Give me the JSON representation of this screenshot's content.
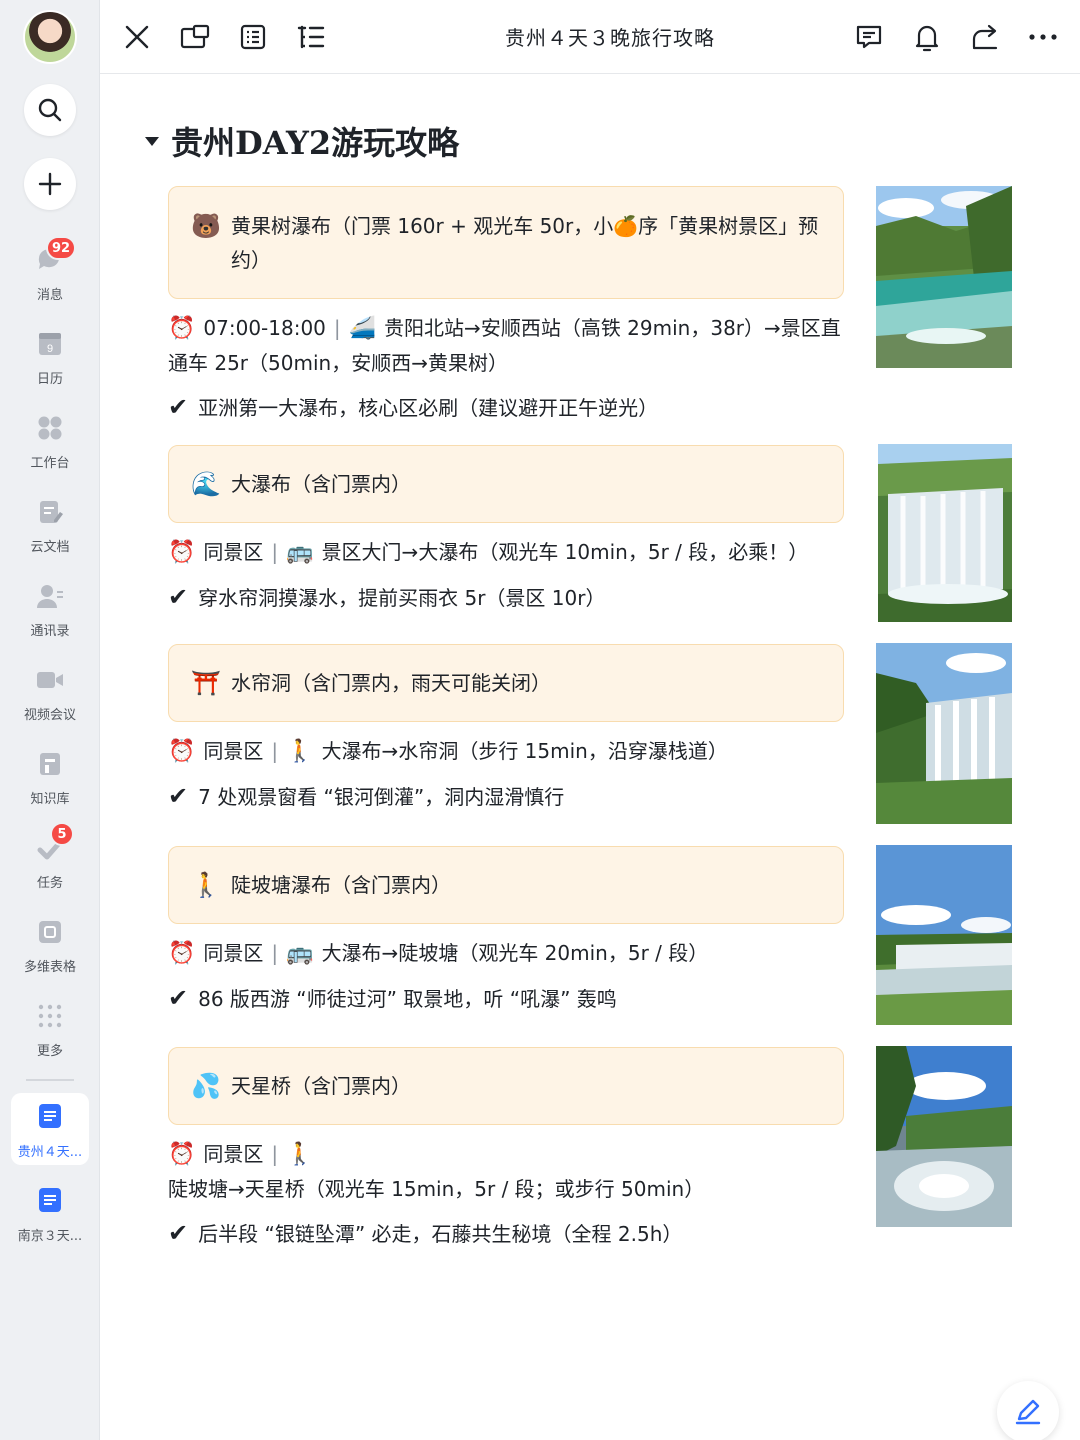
{
  "app": {
    "sidebar": {
      "items": [
        {
          "label": "消息",
          "badge": "92"
        },
        {
          "label": "日历",
          "day": "9"
        },
        {
          "label": "工作台"
        },
        {
          "label": "云文档"
        },
        {
          "label": "通讯录"
        },
        {
          "label": "视频会议"
        },
        {
          "label": "知识库"
        },
        {
          "label": "任务",
          "badge": "5"
        },
        {
          "label": "多维表格"
        },
        {
          "label": "更多"
        }
      ],
      "docs": [
        {
          "label": "贵州４天...",
          "active": true
        },
        {
          "label": "南京３天..."
        }
      ]
    },
    "topbar": {
      "title": "贵州４天３晚旅行攻略"
    }
  },
  "content": {
    "heading": "贵州DAY2游玩攻略",
    "sections": [
      {
        "emoji": "🐻",
        "callout": "黄果树瀑布（门票 160r + 观光车 50r，小🍊序「黄果树景区」预约）",
        "detail_emoji": "⏰",
        "detail": "07:00-18:00",
        "transport_emoji": "🚄",
        "transport": "贵阳北站→安顺西站（高铁 29min，38r）→景区直通车 25r（50min，安顺西→黄果树）",
        "tip": "亚洲第一大瀑布，核心区必刷（建议避开正午逆光）"
      },
      {
        "emoji": "🌊",
        "callout": "大瀑布（含门票内）",
        "detail_emoji": "⏰",
        "detail": "同景区",
        "transport_emoji": "🚌",
        "transport": "景区大门→大瀑布（观光车 10min，5r / 段，必乘！）",
        "tip": "穿水帘洞摸瀑水，提前买雨衣 5r（景区 10r）"
      },
      {
        "emoji": "⛩️",
        "callout": "水帘洞（含门票内，雨天可能关闭）",
        "detail_emoji": "⏰",
        "detail": "同景区",
        "transport_emoji": "🚶",
        "transport": "大瀑布→水帘洞（步行 15min，沿穿瀑栈道）",
        "tip": "7 处观景窗看 “银河倒灌”，洞内湿滑慎行"
      },
      {
        "emoji": "🚶",
        "callout": "陡坡塘瀑布（含门票内）",
        "detail_emoji": "⏰",
        "detail": "同景区",
        "transport_emoji": "🚌",
        "transport": "大瀑布→陡坡塘（观光车 20min，5r / 段）",
        "tip": "86 版西游 “师徒过河” 取景地，听 “吼瀑” 轰鸣"
      },
      {
        "emoji": "💦",
        "callout": "天星桥（含门票内）",
        "detail_emoji": "⏰",
        "detail": "同景区",
        "transport_emoji": "🚶",
        "transport": "陡坡塘→天星桥（观光车 15min，5r / 段；或步行 50min）",
        "tip": "后半段 “银链坠潭” 必走，石藤共生秘境（全程 2.5h）"
      }
    ],
    "check_mark": "✔"
  },
  "colors": {
    "callout_bg": "#fef4e6",
    "callout_border": "#f8dcaf",
    "accent": "#3370ff",
    "badge": "#f54a45"
  }
}
